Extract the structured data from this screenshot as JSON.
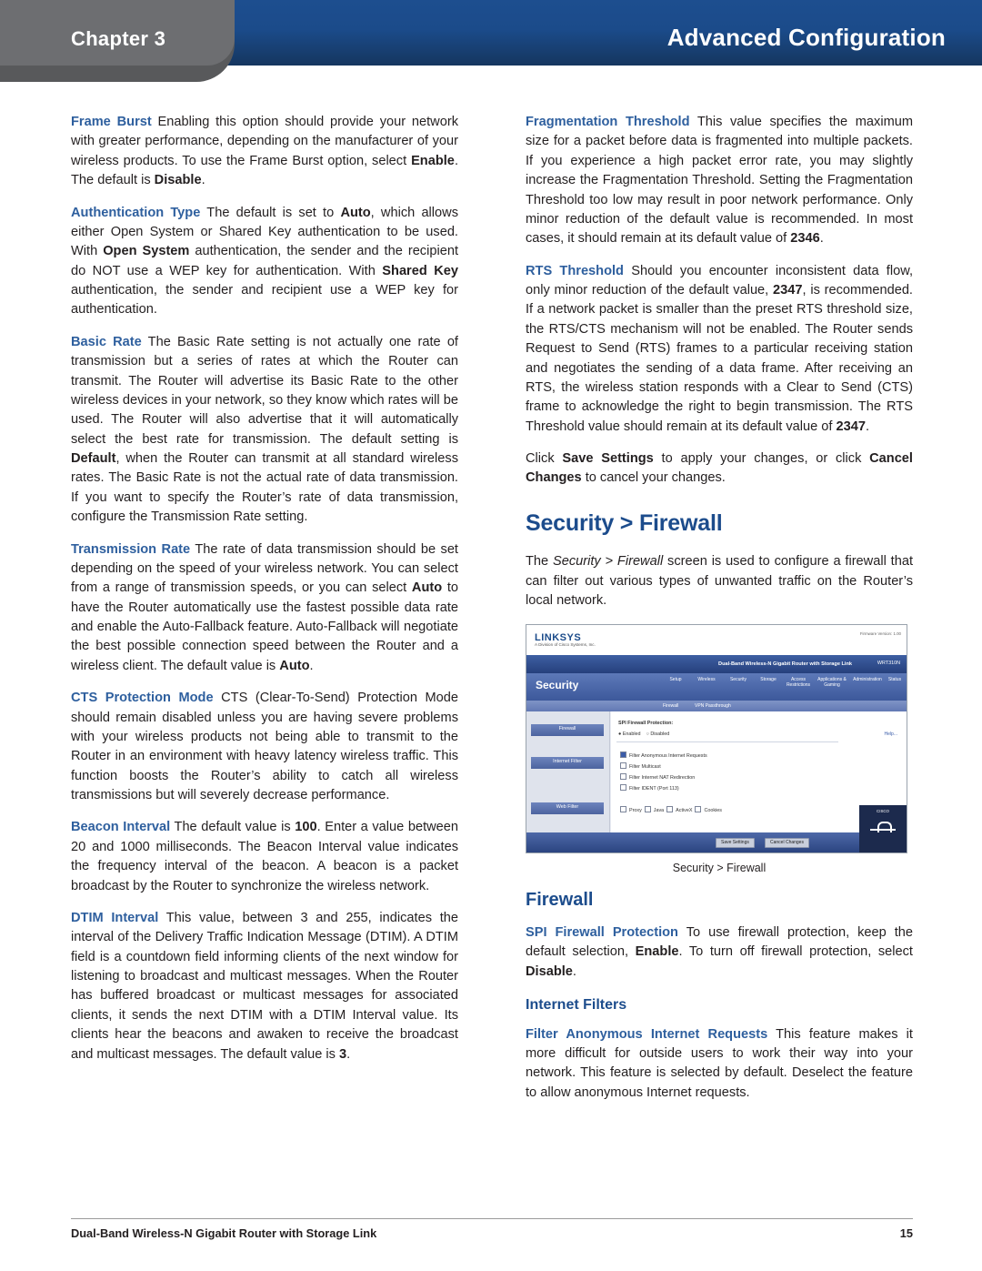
{
  "header": {
    "chapter": "Chapter 3",
    "title": "Advanced Configuration"
  },
  "left_column": {
    "paragraphs": [
      {
        "term": "Frame Burst",
        "body": " Enabling this option should provide your network with greater performance, depending on the manufacturer of your wireless products. To use the Frame Burst option, select <b>Enable</b>. The default is <b>Disable</b>."
      },
      {
        "term": "Authentication Type",
        "body": "  The default is set to <b>Auto</b>, which allows either Open System or Shared Key authentication to be used. With <b>Open System</b> authentication, the sender and the recipient do NOT use a WEP key for authentication. With <b>Shared Key</b> authentication, the sender and recipient use a WEP key for authentication."
      },
      {
        "term": "Basic Rate",
        "body": "  The Basic Rate setting is not actually one rate of transmission but a series of rates at which the Router can transmit. The Router will advertise its Basic Rate to the other wireless devices in your network, so they know which rates will be used. The Router will also advertise that it will automatically select the best rate for transmission. The default setting is <b>Default</b>, when the Router can transmit at all standard wireless rates. The Basic Rate is not the actual rate of data transmission. If you want to specify the Router&rsquo;s rate of data transmission, configure the Transmission Rate setting."
      },
      {
        "term": "Transmission Rate",
        "body": "  The rate of data transmission should be set depending on the speed of your wireless network. You can select from a range of transmission speeds, or you can select <b>Auto</b> to have the Router automatically use the fastest possible data rate and enable the Auto-Fallback feature. Auto-Fallback will negotiate the best possible connection speed between the Router and a wireless client. The default value is <b>Auto</b>."
      },
      {
        "term": "CTS Protection Mode",
        "body": "  CTS (Clear-To-Send) Protection Mode should remain disabled unless you are having severe problems with your wireless products not being able to transmit to the Router in an environment with heavy latency wireless traffic. This function boosts the Router&rsquo;s ability to catch all wireless transmissions but will severely decrease performance."
      },
      {
        "term": "Beacon Interval",
        "body": "  The default value is <b>100</b>. Enter a value between 20 and 1000 milliseconds. The Beacon Interval value indicates the frequency interval of the beacon. A beacon is a packet broadcast by the Router to synchronize the wireless network."
      },
      {
        "term": "DTIM Interval",
        "body": "  This value, between 3 and 255, indicates the interval of the Delivery Traffic Indication Message (DTIM). A DTIM field is a countdown field informing clients of the next window for listening to broadcast and multicast messages. When the Router has buffered broadcast or multicast messages for associated clients, it sends the next DTIM with a DTIM Interval value. Its clients hear the beacons and awaken to receive the broadcast and multicast messages. The default value is <b>3</b>."
      }
    ]
  },
  "right_column": {
    "paragraphs_top": [
      {
        "term": "Fragmentation Threshold",
        "body": "  This value specifies the maximum size for a packet before data is fragmented into multiple packets. If you experience a high packet error rate, you may slightly increase the Fragmentation Threshold. Setting the Fragmentation Threshold too low may result in poor network performance. Only minor reduction of the default value is recommended. In most cases, it should remain at its default value of <b>2346</b>."
      },
      {
        "term": "RTS Threshold",
        "body": "  Should you encounter inconsistent data flow, only minor reduction of the default value, <b>2347</b>, is recommended. If a network packet is smaller than the preset RTS threshold size, the RTS/CTS mechanism will not be enabled. The Router sends Request to Send (RTS) frames to a particular receiving station and negotiates the sending of a data frame. After receiving an RTS, the wireless station responds with a Clear to Send (CTS) frame to acknowledge the right to begin transmission. The RTS Threshold value should remain at its default value of <b>2347</b>."
      },
      {
        "term": "",
        "body": "Click <b>Save Settings</b> to apply your changes, or click <b>Cancel Changes</b> to cancel your changes."
      }
    ],
    "section_title": "Security > Firewall",
    "section_intro": "The <i>Security > Firewall</i> screen is used to configure a firewall that can filter out various types of unwanted traffic on the Router&rsquo;s local network.",
    "figure_caption": "Security > Firewall",
    "firewall_title": "Firewall",
    "firewall_paragraph": {
      "term": "SPI Firewall Protection",
      "body": "  To use firewall protection, keep the default selection, <b>Enable</b>. To turn off firewall protection, select <b>Disable</b>."
    },
    "internet_filters_title": "Internet Filters",
    "internet_filters_paragraph": {
      "term": "Filter Anonymous Internet Requests",
      "body": "  This feature makes it more difficult for outside users to work their way into your network. This feature is selected by default. Deselect the feature to allow anonymous Internet requests."
    }
  },
  "screenshot": {
    "brand": "LINKSYS",
    "brand_sub": "A Division of Cisco Systems, Inc.",
    "version": "Firmware Version: 1.00",
    "product_title": "Dual-Band Wireless-N Gigabit Router with Storage Link",
    "model": "WRT310N",
    "section": "Security",
    "nav": [
      "Setup",
      "Wireless",
      "Security",
      "Storage",
      "Access Restrictions",
      "Applications & Gaming",
      "Administration",
      "Status"
    ],
    "subnav": [
      "Firewall",
      "VPN Passthrough"
    ],
    "sidebar": [
      "Firewall",
      "Internet Filter",
      "Web Filter"
    ],
    "panel_label": "SPI Firewall Protection:",
    "radio_options": [
      "Enabled",
      "Disabled"
    ],
    "help_label": "Help...",
    "checkboxes": [
      {
        "label": "Filter Anonymous Internet Requests",
        "checked": true
      },
      {
        "label": "Filter Multicast",
        "checked": false
      },
      {
        "label": "Filter Internet NAT Redirection",
        "checked": false
      },
      {
        "label": "Filter IDENT (Port 113)",
        "checked": false
      }
    ],
    "web_filters": [
      {
        "label": "Proxy",
        "checked": false
      },
      {
        "label": "Java",
        "checked": false
      },
      {
        "label": "ActiveX",
        "checked": false
      },
      {
        "label": "Cookies",
        "checked": false
      }
    ],
    "buttons": [
      "Save Settings",
      "Cancel Changes"
    ],
    "cisco_brand": "CISCO",
    "cisco_sub": "Cisco Systems"
  },
  "footer": {
    "left": "Dual-Band Wireless-N Gigabit Router with Storage Link",
    "right": "15"
  }
}
